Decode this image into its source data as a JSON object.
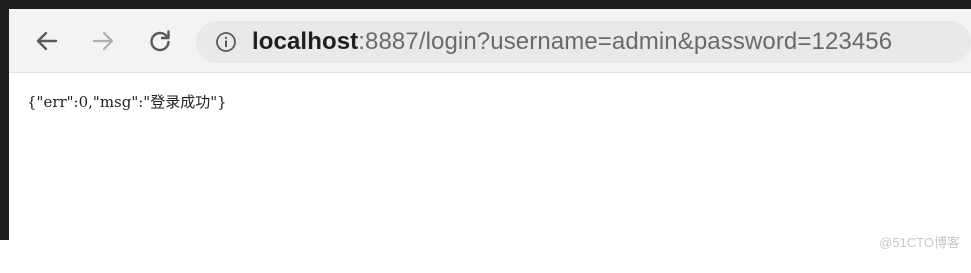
{
  "toolbar": {
    "back_icon": "arrow-left-icon",
    "forward_icon": "arrow-right-icon",
    "reload_icon": "reload-icon",
    "info_icon": "info-circle-icon"
  },
  "address_bar": {
    "host": "localhost",
    "rest": ":8887/login?username=admin&password=123456"
  },
  "page": {
    "body_text": "{\"err\":0,\"msg\":\"登录成功\"}"
  },
  "watermark": {
    "text": "@51CTO博客"
  },
  "colors": {
    "toolbar_bg": "#f3f3f3",
    "omnibox_bg": "#e9e9e9",
    "frame": "#1e1e1e",
    "disabled_icon": "#b0b0b0"
  }
}
